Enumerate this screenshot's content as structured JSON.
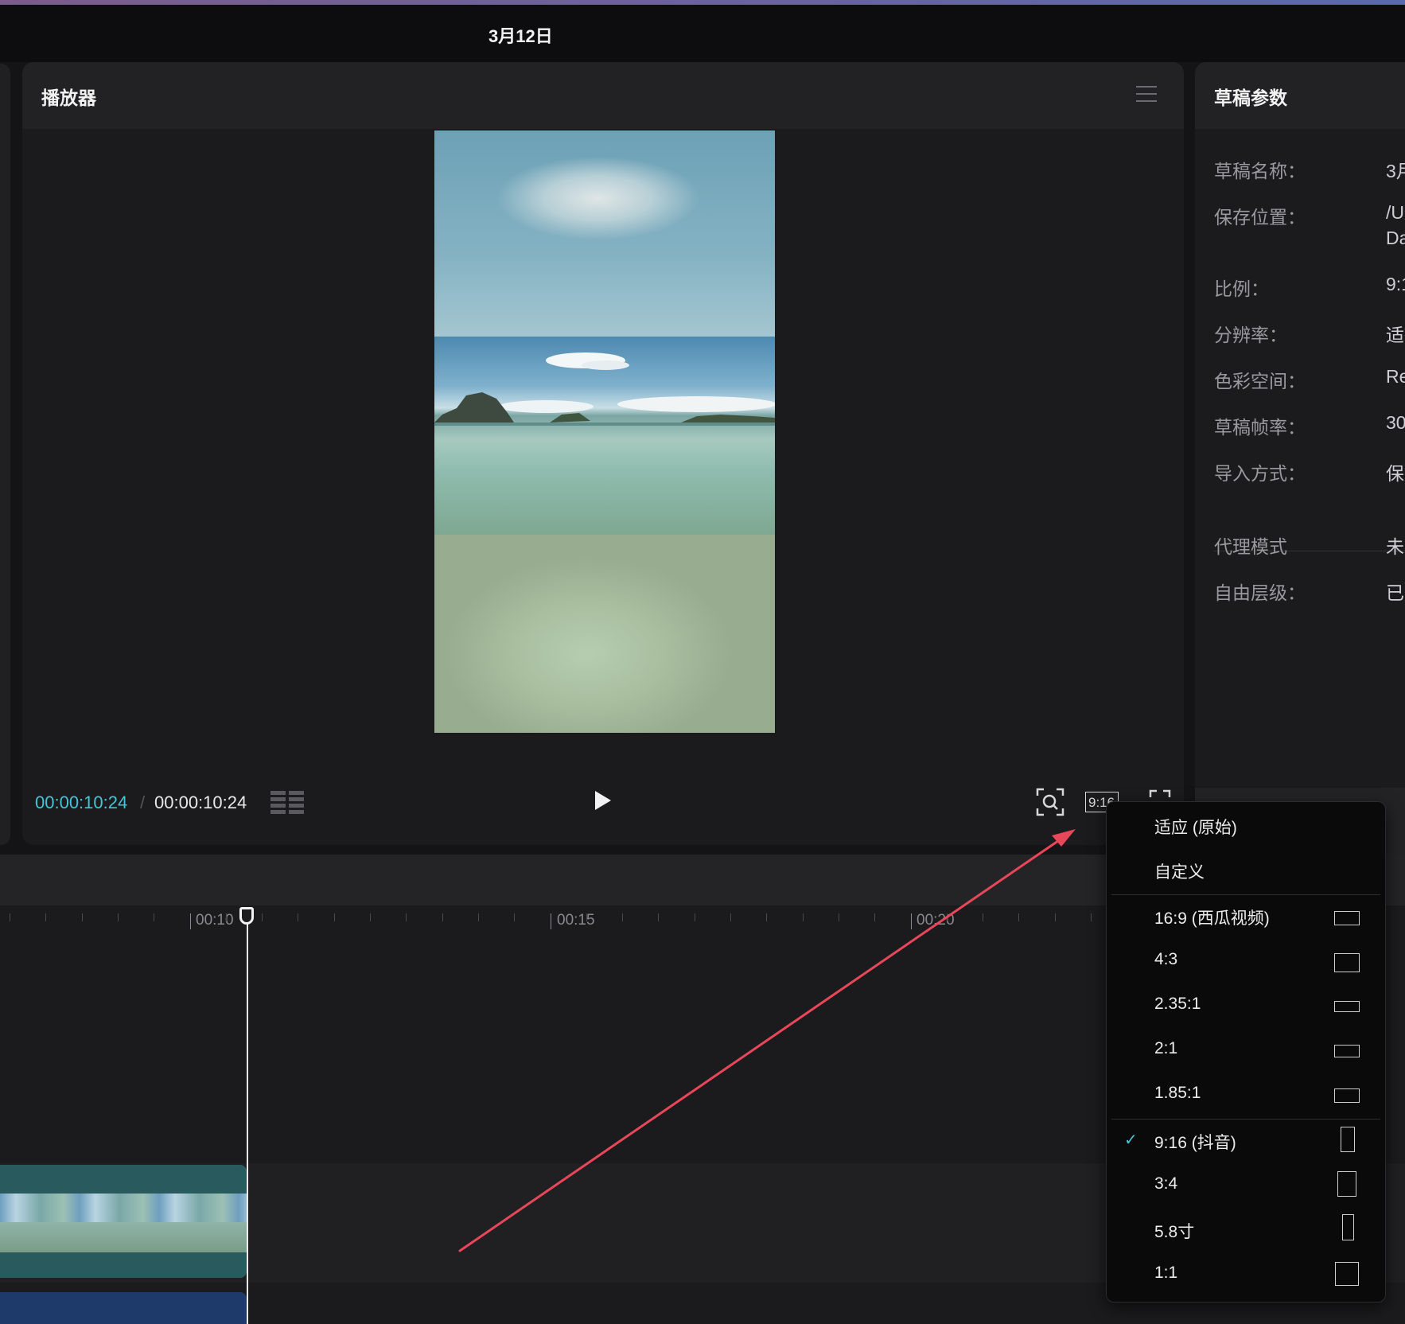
{
  "window": {
    "title": "3月12日"
  },
  "player": {
    "title": "播放器",
    "current_time": "00:00:10:24",
    "separator": "/",
    "total_time": "00:00:10:24",
    "ratio_button": "9:16"
  },
  "draft": {
    "title": "草稿参数",
    "rows": [
      {
        "label": "草稿名称：",
        "value": "3月"
      },
      {
        "label": "保存位置：",
        "value": "/U"
      },
      {
        "label": "比例：",
        "value": "9:1"
      },
      {
        "label": "分辨率：",
        "value": "适"
      },
      {
        "label": "色彩空间：",
        "value": "Re"
      },
      {
        "label": "草稿帧率：",
        "value": "30"
      },
      {
        "label": "导入方式：",
        "value": "保"
      },
      {
        "label": "代理模式",
        "value": "未"
      },
      {
        "label": "自由层级：",
        "value": "已"
      }
    ],
    "location_line2": "Da"
  },
  "timeline": {
    "ruler_labels": [
      "00:10",
      "00:15",
      "00:20"
    ]
  },
  "ratio_menu": {
    "items": [
      {
        "label": "适应 (原始)",
        "shape": "none"
      },
      {
        "label": "自定义",
        "shape": "none"
      },
      {
        "label": "16:9 (西瓜视频)",
        "shape": "wide"
      },
      {
        "label": "4:3",
        "shape": "four-three"
      },
      {
        "label": "2.35:1",
        "shape": "cinema"
      },
      {
        "label": "2:1",
        "shape": "two-one"
      },
      {
        "label": "1.85:1",
        "shape": "one-eighty-five"
      },
      {
        "label": "9:16 (抖音)",
        "shape": "tall",
        "selected": true
      },
      {
        "label": "3:4",
        "shape": "three-four"
      },
      {
        "label": "5.8寸",
        "shape": "phone"
      },
      {
        "label": "1:1",
        "shape": "square"
      }
    ],
    "check": "✓"
  },
  "colors": {
    "accent": "#44c6d6",
    "arrow": "#e8475a"
  }
}
